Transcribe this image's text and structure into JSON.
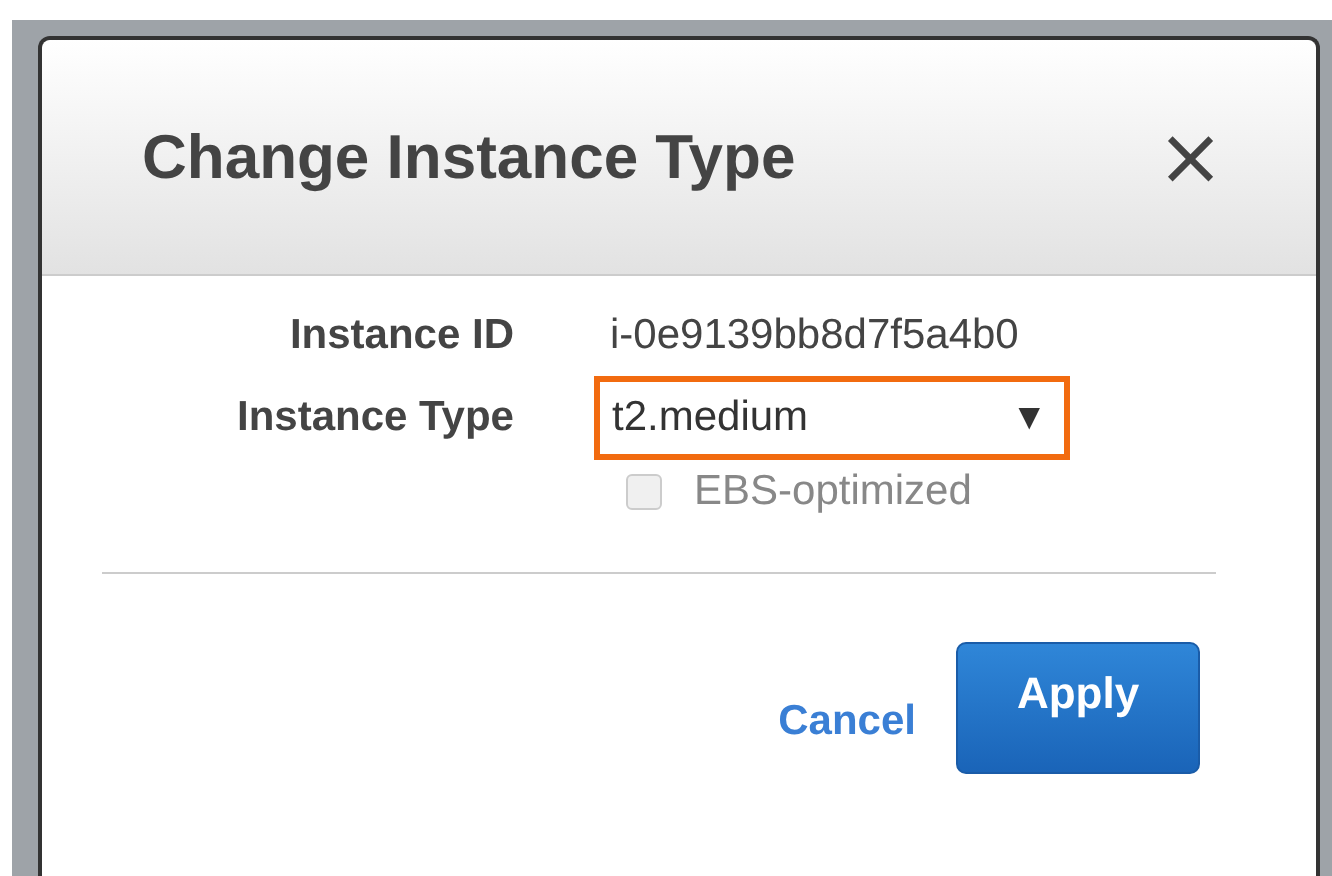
{
  "dialog": {
    "title": "Change Instance Type",
    "close": "×",
    "fields": [
      {
        "kind": "text",
        "label": "Instance ID",
        "value": "i-0e9139bb8d7f5a4b0"
      },
      {
        "kind": "select",
        "label": "Instance Type",
        "value": "t2.medium",
        "arrow": "▼",
        "highlighted": true
      }
    ],
    "checkbox": {
      "label": "EBS-optimized",
      "checked": false,
      "disabled": true
    },
    "buttons": [
      {
        "kind": "link",
        "label": "Cancel"
      },
      {
        "kind": "primary",
        "label": "Apply"
      }
    ]
  }
}
